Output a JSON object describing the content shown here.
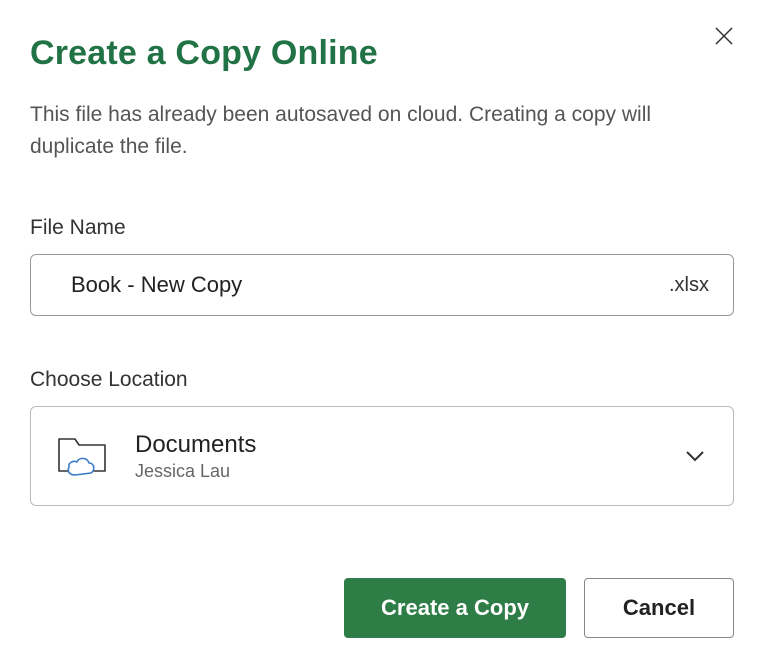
{
  "dialog": {
    "title": "Create a Copy Online",
    "description": "This file has already been autosaved on cloud. Creating a copy will duplicate the file."
  },
  "filename": {
    "label": "File Name",
    "value": "Book - New Copy",
    "extension": ".xlsx"
  },
  "location": {
    "label": "Choose Location",
    "name": "Documents",
    "subtitle": "Jessica Lau"
  },
  "buttons": {
    "primary": "Create a Copy",
    "secondary": "Cancel"
  }
}
